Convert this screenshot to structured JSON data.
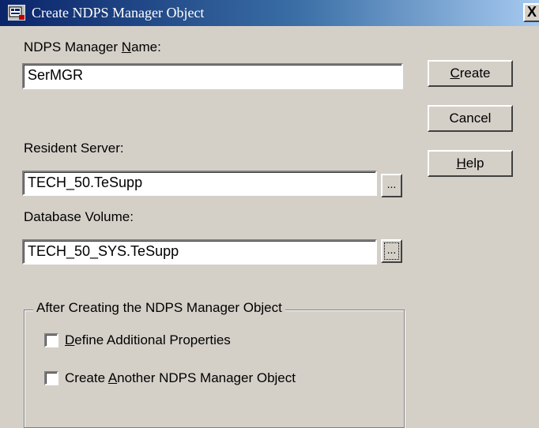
{
  "window": {
    "title": "Create NDPS Manager Object",
    "close_glyph": "X"
  },
  "form": {
    "manager_name": {
      "label_pre": "NDPS Manager ",
      "label_accel": "N",
      "label_post": "ame:",
      "value": "SerMGR"
    },
    "resident_server": {
      "label": "Resident Server:",
      "value": "TECH_50.TeSupp",
      "browse_label": "..."
    },
    "database_volume": {
      "label": "Database Volume:",
      "value": "TECH_50_SYS.TeSupp",
      "browse_label": "..."
    }
  },
  "buttons": {
    "create": {
      "accel": "C",
      "rest": "reate"
    },
    "cancel": {
      "label": "Cancel"
    },
    "help": {
      "accel": "H",
      "rest": "elp"
    }
  },
  "after_group": {
    "legend": "After Creating the NDPS Manager Object",
    "define_props": {
      "accel": "D",
      "rest": "efine Additional Properties",
      "checked": false
    },
    "create_another": {
      "pre": "Create ",
      "accel": "A",
      "rest": "nother NDPS Manager Object",
      "checked": false
    }
  }
}
